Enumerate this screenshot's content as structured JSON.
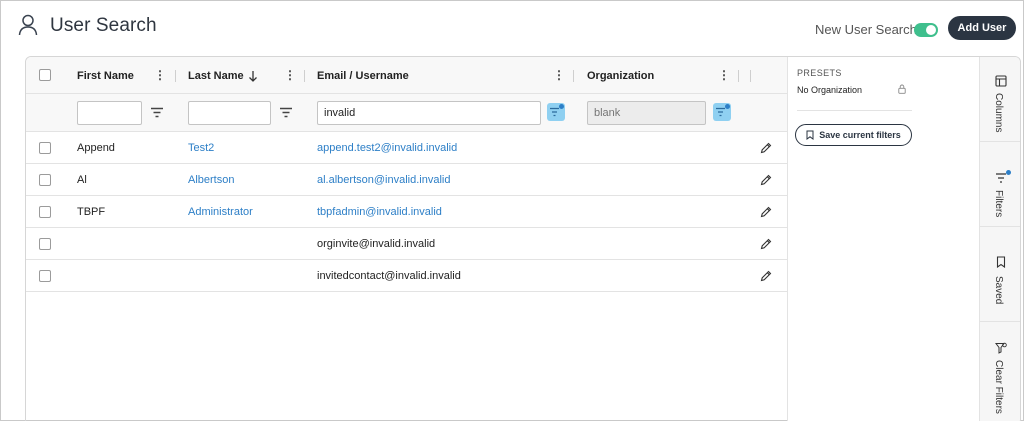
{
  "header": {
    "title": "User Search",
    "new_user_search_label": "New User Search",
    "new_user_search_on": true,
    "add_user_label": "Add User"
  },
  "columns": [
    {
      "label": "First Name"
    },
    {
      "label": "Last Name",
      "sort": "descending"
    },
    {
      "label": "Email / Username"
    },
    {
      "label": "Organization"
    }
  ],
  "filters": {
    "first_name": "",
    "last_name": "",
    "email": "invalid",
    "organization_placeholder": "blank"
  },
  "rows": [
    {
      "first": "Append",
      "last": "Test2",
      "email": "append.test2@invalid.invalid",
      "email_link": true
    },
    {
      "first": "Al",
      "last": "Albertson",
      "email": "al.albertson@invalid.invalid",
      "email_link": true
    },
    {
      "first": "TBPF",
      "last": "Administrator",
      "email": "tbpfadmin@invalid.invalid",
      "email_link": true
    },
    {
      "first": "",
      "last": "",
      "email": "orginvite@invalid.invalid",
      "email_link": false
    },
    {
      "first": "",
      "last": "",
      "email": "invitedcontact@invalid.invalid",
      "email_link": false
    }
  ],
  "presets": {
    "title": "PRESETS",
    "items": [
      "No Organization"
    ],
    "save_label": "Save current filters"
  },
  "side_tabs": [
    "Columns",
    "Filters",
    "Saved",
    "Clear Filters"
  ],
  "colors": {
    "accent": "#2d7fc7",
    "primary_button": "#2b3542",
    "toggle_on": "#3fbf8d",
    "filter_active": "#8fd0f1"
  }
}
